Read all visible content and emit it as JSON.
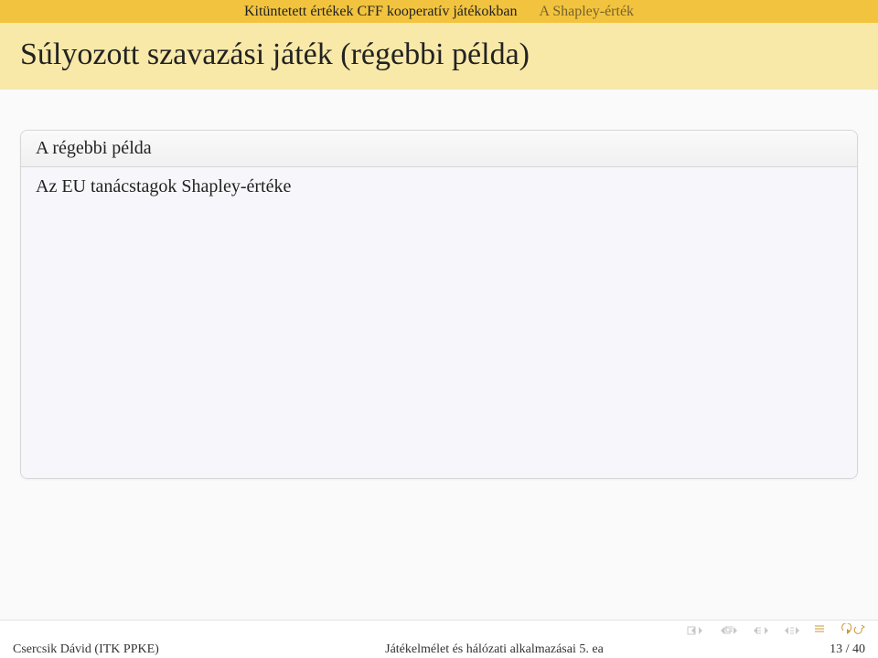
{
  "nav": {
    "section": "Kitüntetett értékek CFF kooperatív játékokban",
    "subsection": "A Shapley-érték"
  },
  "title": "Súlyozott szavazási játék (régebbi példa)",
  "block": {
    "heading": "A régebbi példa",
    "line1": "Az EU tanácstagok Shapley-értéke"
  },
  "footer": {
    "author": "Csercsik Dávid (ITK PPKE)",
    "lecture": "Játékelmélet és hálózati alkalmazásai 5. ea",
    "page": "13 / 40"
  }
}
